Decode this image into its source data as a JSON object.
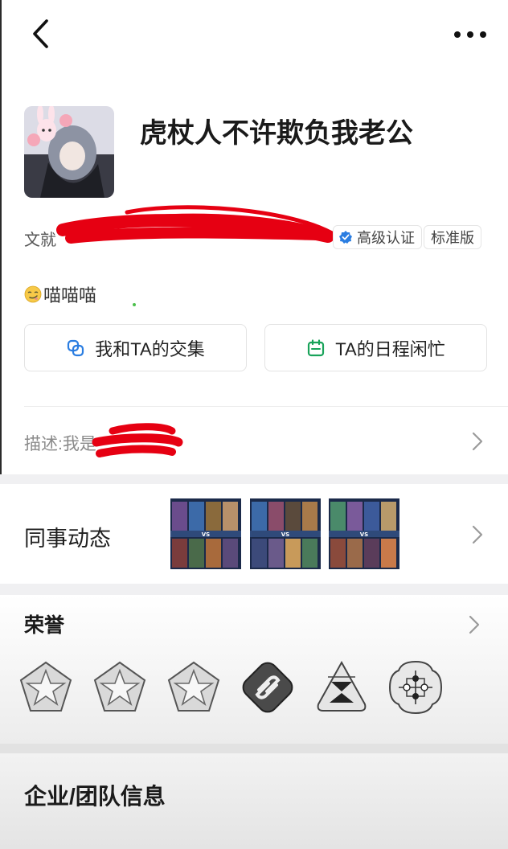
{
  "profile": {
    "name": "虎杖人不许欺负我老公",
    "info_text": "文就",
    "verified_label": "高级认证",
    "edition_label": "标准版",
    "status_text": "喵喵喵"
  },
  "actions": {
    "intersect_label": "我和TA的交集",
    "schedule_label": "TA的日程闲忙"
  },
  "description": {
    "text": "描述:我是"
  },
  "colleague": {
    "label": "同事动态",
    "thumbnails": [
      "game-match-screenshot",
      "game-match-screenshot",
      "game-match-screenshot"
    ]
  },
  "honors": {
    "title": "荣誉",
    "medals": [
      "star-medal",
      "star-medal",
      "star-medal",
      "link-medal",
      "hourglass-medal",
      "nodes-medal"
    ]
  },
  "company": {
    "title": "企业/团队信息"
  },
  "colors": {
    "accent_blue": "#2a7de1",
    "accent_green": "#19a35a",
    "scribble_red": "#e60012"
  }
}
